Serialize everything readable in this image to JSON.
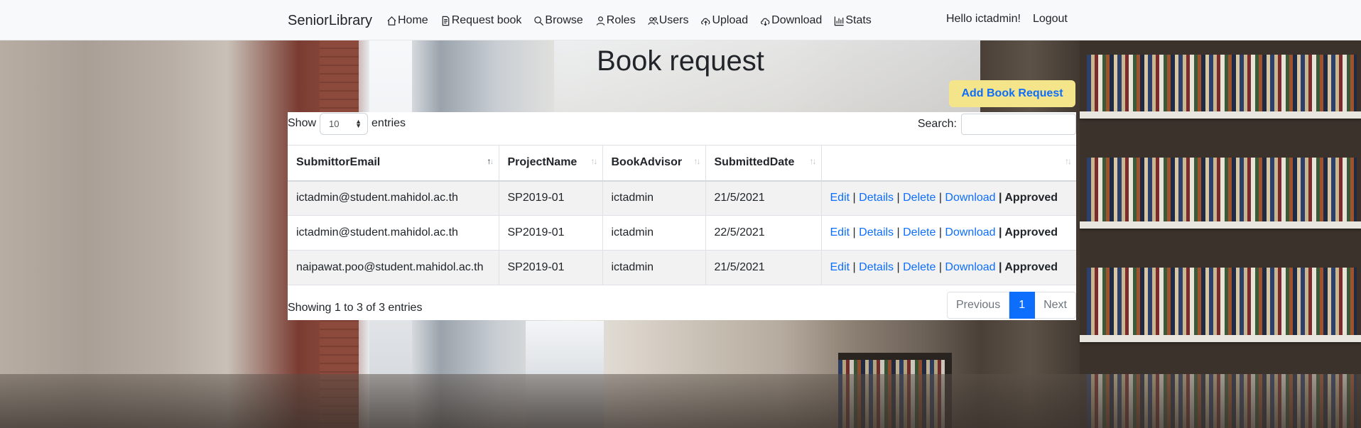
{
  "navbar": {
    "brand": "SeniorLibrary",
    "links": [
      {
        "label": "Home",
        "icon": "house-icon"
      },
      {
        "label": "Request book",
        "icon": "file-text-icon"
      },
      {
        "label": "Browse",
        "icon": "search-icon"
      },
      {
        "label": "Roles",
        "icon": "person-icon"
      },
      {
        "label": "Users",
        "icon": "people-icon"
      },
      {
        "label": "Upload",
        "icon": "cloud-upload-icon"
      },
      {
        "label": "Download",
        "icon": "cloud-download-icon"
      },
      {
        "label": "Stats",
        "icon": "bar-chart-icon"
      }
    ],
    "greeting": "Hello ictadmin!",
    "logout": "Logout"
  },
  "page": {
    "title": "Book request",
    "add_button": "Add Book Request"
  },
  "table_controls": {
    "show_label": "Show",
    "entries_label": "entries",
    "page_length": "10",
    "search_label": "Search:",
    "search_value": ""
  },
  "table": {
    "columns": [
      "SubmittorEmail",
      "ProjectName",
      "BookAdvisor",
      "SubmittedDate",
      ""
    ],
    "actions": {
      "edit": "Edit",
      "details": "Details",
      "delete": "Delete",
      "download": "Download",
      "separator": "|"
    },
    "rows": [
      {
        "email": "ictadmin@student.mahidol.ac.th",
        "project": "SP2019-01",
        "advisor": "ictadmin",
        "date": "21/5/2021",
        "status": "Approved"
      },
      {
        "email": "ictadmin@student.mahidol.ac.th",
        "project": "SP2019-01",
        "advisor": "ictadmin",
        "date": "22/5/2021",
        "status": "Approved"
      },
      {
        "email": "naipawat.poo@student.mahidol.ac.th",
        "project": "SP2019-01",
        "advisor": "ictadmin",
        "date": "21/5/2021",
        "status": "Approved"
      }
    ]
  },
  "footer": {
    "info": "Showing 1 to 3 of 3 entries",
    "previous": "Previous",
    "current_page": "1",
    "next": "Next"
  },
  "colors": {
    "accent": "#0d6efd",
    "add_button_bg": "#f4e48a",
    "navbar_bg": "#f8f9fa"
  }
}
